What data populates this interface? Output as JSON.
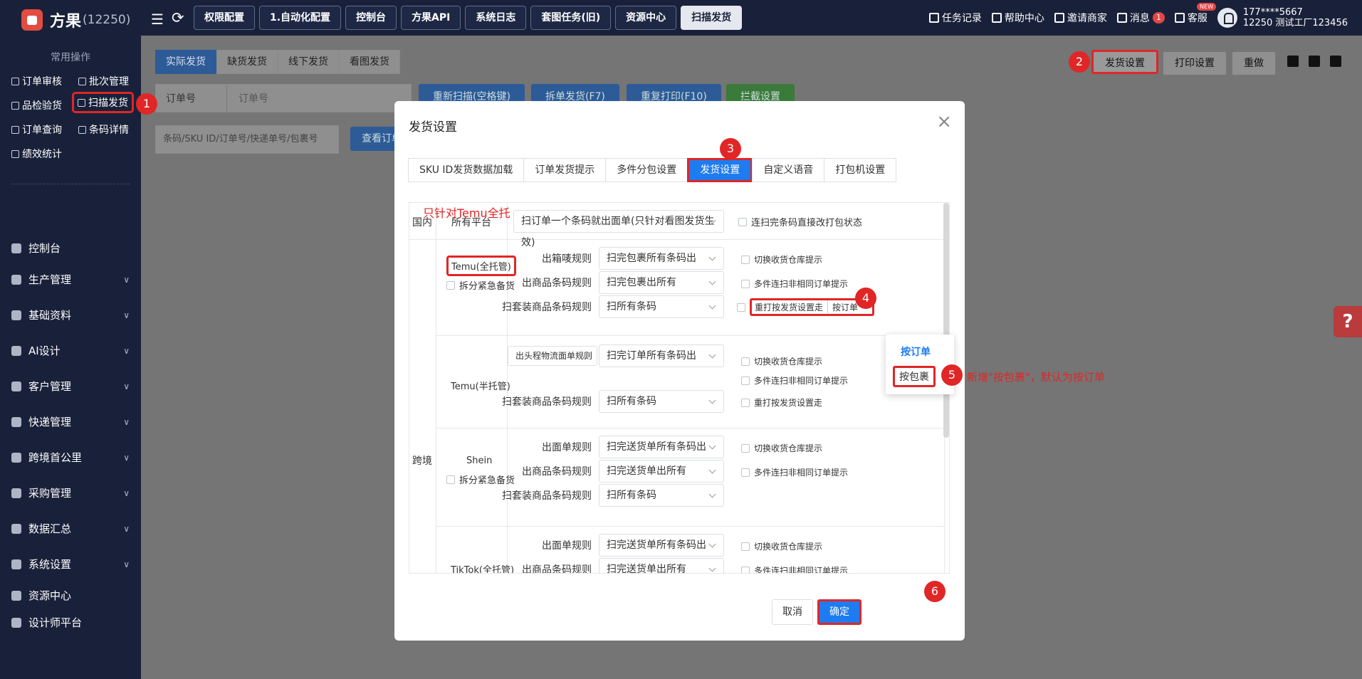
{
  "topbar": {
    "app_name": "方果",
    "count": "(12250)",
    "tabs": [
      "权限配置",
      "1.自动化配置",
      "控制台",
      "方果API",
      "系统日志",
      "套图任务(旧)",
      "资源中心",
      "扫描发货"
    ],
    "active_tab": "扫描发货",
    "right": {
      "tasks": "任务记录",
      "help": "帮助中心",
      "invite": "邀请商家",
      "messages": "消息",
      "msg_count": "1",
      "service": "客服",
      "new_badge": "NEW",
      "user_line1": "177****5667",
      "user_line2": "12250 测试工厂123456"
    }
  },
  "sidebar": {
    "section_title": "常用操作",
    "quick": [
      "订单审核",
      "批次管理",
      "品检验货",
      "扫描发货",
      "订单查询",
      "条码详情",
      "绩效统计"
    ],
    "menu": [
      {
        "label": "控制台",
        "chev": false
      },
      {
        "label": "生产管理",
        "chev": true
      },
      {
        "label": "基础资料",
        "chev": true
      },
      {
        "label": "AI设计",
        "chev": true
      },
      {
        "label": "客户管理",
        "chev": true
      },
      {
        "label": "快递管理",
        "chev": true
      },
      {
        "label": "跨境首公里",
        "chev": true
      },
      {
        "label": "采购管理",
        "chev": true
      },
      {
        "label": "数据汇总",
        "chev": true
      },
      {
        "label": "系统设置",
        "chev": true
      },
      {
        "label": "资源中心",
        "chev": false
      },
      {
        "label": "设计师平台",
        "chev": false
      }
    ]
  },
  "bg": {
    "tabs": [
      "实际发货",
      "缺货发货",
      "线下发货",
      "看图发货"
    ],
    "select": "订单号",
    "select_ph": "订单号",
    "btns": [
      "重新扫描(空格键)",
      "拆单发货(F7)",
      "重复打印(F10)",
      "拦截设置"
    ],
    "input_ph": "条码/SKU ID/订单号/快递单号/包裹号",
    "query_btn": "查看订单",
    "right_btns": [
      "发货设置",
      "打印设置",
      "重做"
    ]
  },
  "modal": {
    "title": "发货设置",
    "tabs": [
      "SKU ID发货数据加载",
      "订单发货提示",
      "多件分包设置",
      "发货设置",
      "自定义语音",
      "打包机设置"
    ],
    "active_tab": "发货设置",
    "domestic": "国内",
    "all_platform": "所有平台",
    "all_platform_sel": "扫订单一个条码就出面单(只针对看图发货生效)",
    "all_platform_chk": "连扫完条码直接改打包状态",
    "cross": "跨境",
    "note_temu": "只针对Temu全托",
    "platforms": [
      {
        "name": "Temu(全托管)",
        "chk": "拆分紧急备货",
        "rows": [
          {
            "label": "出箱唛规则",
            "sel": "扫完包裹所有条码出",
            "opt": "切换收货仓库提示"
          },
          {
            "label": "出商品条码规则",
            "sel": "扫完包裹出所有",
            "opt": "多件连扫非相同订单提示"
          },
          {
            "label": "扫套装商品条码规则",
            "sel": "扫所有条码",
            "opt": "重打按发货设置走",
            "opt_sel": "按订单"
          }
        ]
      },
      {
        "name": "Temu(半托管)",
        "rows": [
          {
            "label": "出头程物流面单规则",
            "sel": "扫完订单所有条码出",
            "opt": "切换收货仓库提示"
          },
          {
            "label": "",
            "sel": "",
            "opt": "多件连扫非相同订单提示"
          },
          {
            "label": "扫套装商品条码规则",
            "sel": "扫所有条码",
            "opt": "重打按发货设置走"
          }
        ]
      },
      {
        "name": "Shein",
        "chk": "拆分紧急备货",
        "rows": [
          {
            "label": "出面单规则",
            "sel": "扫完送货单所有条码出",
            "opt": "切换收货仓库提示"
          },
          {
            "label": "出商品条码规则",
            "sel": "扫完送货单出所有",
            "opt": "多件连扫非相同订单提示"
          },
          {
            "label": "扫套装商品条码规则",
            "sel": "扫所有条码",
            "opt": ""
          }
        ]
      },
      {
        "name": "TikTok(全托管)",
        "rows": [
          {
            "label": "出面单规则",
            "sel": "扫完送货单所有条码出",
            "opt": "切换收货仓库提示"
          },
          {
            "label": "出商品条码规则",
            "sel": "扫完送货单出所有",
            "opt": "多件连扫非相同订单提示"
          }
        ]
      }
    ],
    "dropdown": [
      "按订单",
      "按包裹"
    ],
    "note_new": "新增\"按包裹\"，默认为按订单",
    "cancel": "取消",
    "confirm": "确定"
  },
  "steps": [
    "1",
    "2",
    "3",
    "4",
    "5",
    "6"
  ]
}
